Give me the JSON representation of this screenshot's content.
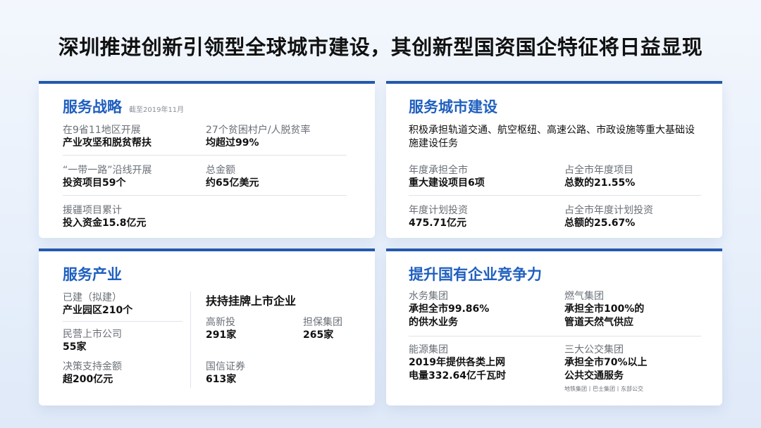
{
  "title": "深圳推进创新引领型全球城市建设，其创新型国资国企特征将日益显现",
  "strategy": {
    "title": "服务战略",
    "note": "截至2019年11月",
    "items": [
      {
        "label": "在9省11地区开展",
        "value": "产业攻坚和脱贫帮扶"
      },
      {
        "label": "27个贫困村户/人脱贫率",
        "value": "均超过99%"
      },
      {
        "label": "“一带一路”沿线开展",
        "value": "投资项目59个"
      },
      {
        "label": "总金额",
        "value": "约65亿美元"
      },
      {
        "label": "援疆项目累计",
        "value": "投入资金15.8亿元"
      }
    ]
  },
  "city": {
    "title": "服务城市建设",
    "desc": "积极承担轨道交通、航空枢纽、高速公路、市政设施等重大基础设施建设任务",
    "items": [
      {
        "label": "年度承担全市",
        "value": "重大建设项目6项"
      },
      {
        "label": "占全市年度项目",
        "value": "总数的21.55%"
      },
      {
        "label": "年度计划投资",
        "value": "475.71亿元"
      },
      {
        "label": "占全市年度计划投资",
        "value": "总额的25.67%"
      }
    ]
  },
  "industry": {
    "title": "服务产业",
    "items": [
      {
        "label": "已建（拟建）",
        "value": "产业园区210个"
      },
      {
        "label": "民营上市公司",
        "value": "55家"
      },
      {
        "label": "决策支持金额",
        "value": "超200亿元"
      }
    ],
    "listed_title": "扶持挂牌上市企业",
    "listed": [
      {
        "label": "高新投",
        "value": "291家"
      },
      {
        "label": "担保集团",
        "value": "265家"
      },
      {
        "label": "国信证券",
        "value": "613家"
      }
    ]
  },
  "compete": {
    "title": "提升国有企业竞争力",
    "items": [
      {
        "label": "水务集团",
        "value1": "承担全市99.86%",
        "value2": "的供水业务"
      },
      {
        "label": "燃气集团",
        "value1": "承担全市100%的",
        "value2": "管道天然气供应"
      },
      {
        "label": "能源集团",
        "value1": "2019年提供各类上网",
        "value2": "电量332.64亿千瓦时"
      },
      {
        "label": "三大公交集团",
        "value1": "承担全市70%以上",
        "value2": "公共交通服务"
      }
    ],
    "footnote": "地铁集团丨巴士集团丨东部公交"
  }
}
